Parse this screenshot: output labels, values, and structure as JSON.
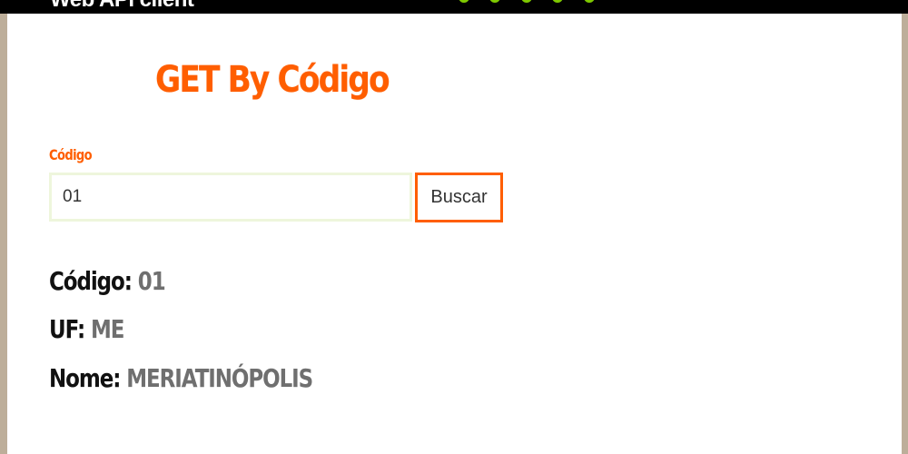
{
  "header": {
    "brand": "Web API client"
  },
  "form": {
    "title": "GET By Código",
    "label": "Código",
    "input_value": "01",
    "button_label": "Buscar"
  },
  "result": {
    "codigo_label": "Código:",
    "codigo_value": "01",
    "uf_label": "UF:",
    "uf_value": "ME",
    "nome_label": "Nome:",
    "nome_value": "MERIATINÓPOLIS"
  },
  "colors": {
    "accent": "#ff5e00",
    "nav_green": "#7ec800",
    "value_gray": "#6f6f6f"
  }
}
